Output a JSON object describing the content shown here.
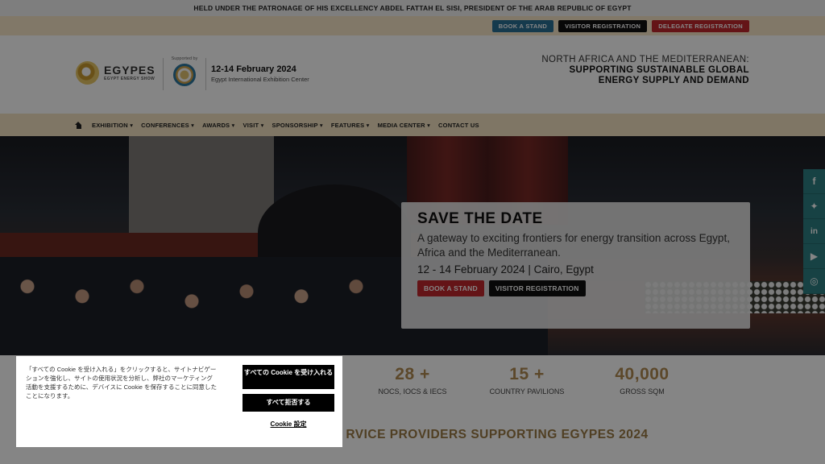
{
  "patronage": "HELD UNDER THE PATRONAGE OF HIS EXCELLENCY ABDEL FATTAH EL SISI, PRESIDENT OF THE ARAB REPUBLIC OF EGYPT",
  "topbar": {
    "book_stand": "BOOK A STAND",
    "visitor_registration": "VISITOR REGISTRATION",
    "delegate_registration": "DELEGATE REGISTRATION"
  },
  "header": {
    "logo_main": "EGYPES",
    "logo_sub": "EGYPT ENERGY SHOW",
    "supported_by": "Supported by",
    "date": "12-14 February 2024",
    "venue": "Egypt International Exhibition Center",
    "tagline_1": "NORTH AFRICA AND THE MEDITERRANEAN:",
    "tagline_2": "SUPPORTING SUSTAINABLE GLOBAL",
    "tagline_3": "ENERGY SUPPLY AND DEMAND"
  },
  "nav": {
    "items": [
      "EXHIBITION",
      "CONFERENCES",
      "AWARDS",
      "VISIT",
      "SPONSORSHIP",
      "FEATURES",
      "MEDIA CENTER",
      "CONTACT US"
    ]
  },
  "hero": {
    "title": "SAVE THE DATE",
    "description": "A gateway to exciting frontiers for energy transition across Egypt, Africa and the Mediterranean.",
    "date": "12 - 14 February 2024 | Cairo, Egypt",
    "book_stand": "BOOK A STAND",
    "visitor_registration": "VISITOR REGISTRATION"
  },
  "social": [
    "f",
    "t",
    "in",
    "yt",
    "ig"
  ],
  "stats": [
    {
      "number": "28 +",
      "label": "NOCS, IOCS & IECS"
    },
    {
      "number": "15 +",
      "label": "COUNTRY PAVILIONS"
    },
    {
      "number": "40,000",
      "label": "GROSS SQM"
    }
  ],
  "providers_title": "RVICE PROVIDERS SUPPORTING EGYPES 2024",
  "cookie": {
    "text": "「すべての Cookie を受け入れる」をクリックすると、サイトナビゲーションを強化し、サイトの使用状況を分析し、弊社のマーケティング活動を支援するために、デバイスに Cookie を保存することに同意したことになります。",
    "accept_all": "すべての Cookie を受け入れる",
    "reject_all": "すべて拒否する",
    "settings": "Cookie 設定"
  },
  "colors": {
    "accent_gold": "#b08a52",
    "nav_bg": "#f3e3c2",
    "btn_blue": "#2a6f95",
    "btn_red": "#c0272d",
    "social_teal": "#2d7f83"
  }
}
